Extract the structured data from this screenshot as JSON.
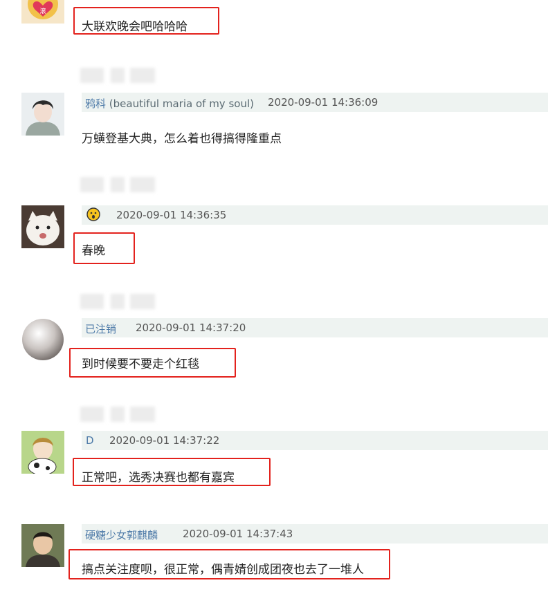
{
  "comments": [
    {
      "id": "c0",
      "username": "",
      "username_extra": "",
      "timestamp": "",
      "content": "大联欢晚会吧哈哈哈",
      "highlighted": true,
      "avatar": "heart-sticker"
    },
    {
      "id": "c1",
      "username": "鸦科",
      "username_extra": "(beautiful maria of my soul)",
      "timestamp": "2020-09-01 14:36:09",
      "content": "万蟥登基大典，怎么着也得搞得隆重点",
      "highlighted": false,
      "avatar": "anime-boy"
    },
    {
      "id": "c2",
      "username": "",
      "username_extra": "",
      "username_icon": "surprised-emoji-icon",
      "timestamp": "2020-09-01 14:36:35",
      "content": "春晚",
      "highlighted": true,
      "avatar": "white-cat"
    },
    {
      "id": "c3",
      "username": "已注销",
      "username_extra": "",
      "timestamp": "2020-09-01 14:37:20",
      "content": "到时候要不要走个红毯",
      "highlighted": true,
      "avatar": "pearl"
    },
    {
      "id": "c4",
      "username": "D",
      "username_extra": "",
      "timestamp": "2020-09-01 14:37:22",
      "content": "正常吧，选秀决赛也都有嘉宾",
      "highlighted": true,
      "avatar": "anime-cow"
    },
    {
      "id": "c5",
      "username": "硬糖少女郭麒麟",
      "username_extra": "",
      "timestamp": "2020-09-01 14:37:43",
      "content": "搞点关注度呗，很正常，偶青婧创成团夜也去了一堆人",
      "highlighted": true,
      "avatar": "person-photo"
    }
  ],
  "colors": {
    "highlight_border": "#e3221d",
    "username": "#4d7aa8",
    "meta_bg": "#eef3f1",
    "text": "#222222"
  }
}
